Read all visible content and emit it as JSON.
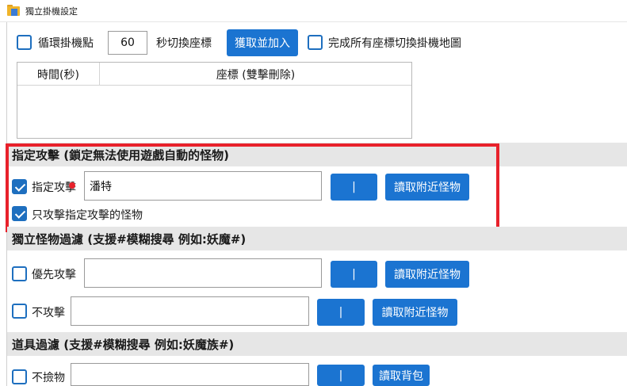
{
  "window": {
    "title": "獨立掛機設定"
  },
  "loop": {
    "checkbox_label": "循環掛機點",
    "seconds_value": "60",
    "suffix_label": "秒切換座標",
    "fetch_button": "獲取並加入",
    "complete_label": "完成所有座標切換掛機地圖"
  },
  "coords_table": {
    "col_time": "時間(秒)",
    "col_coord": "座標 (雙擊刪除)"
  },
  "target_attack": {
    "header": "指定攻擊 (鎖定無法使用遊戲自動的怪物)",
    "checkbox_label": "指定攻擊",
    "input_value": "潘特",
    "sep_button": "|",
    "read_button": "讀取附近怪物",
    "only_label": "只攻擊指定攻擊的怪物"
  },
  "monster_filter": {
    "header": "獨立怪物過濾 (支援#模糊搜尋 例如:妖魔#)",
    "priority_label": "優先攻擊",
    "priority_value": "",
    "no_attack_label": "不攻擊",
    "no_attack_value": "",
    "sep_button": "|",
    "read_button": "讀取附近怪物"
  },
  "item_filter": {
    "header": "道具過濾 (支援#模糊搜尋 例如:妖魔族#)",
    "no_pick_label": "不撿物",
    "no_pick_value": "",
    "sep_button": "|",
    "read_button": "讀取背包"
  },
  "colors": {
    "accent": "#1b74d1",
    "highlight": "#e8212b",
    "section_bg": "#e6e6e6"
  }
}
